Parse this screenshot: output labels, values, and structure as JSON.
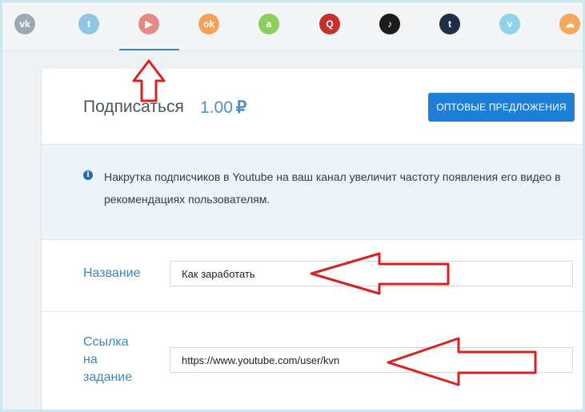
{
  "social_networks": [
    {
      "name": "vk-icon",
      "glyph": "vk",
      "color": "#9aa9b6"
    },
    {
      "name": "twitter-icon",
      "glyph": "t",
      "color": "#8fc6e8"
    },
    {
      "name": "youtube-icon",
      "glyph": "▶",
      "color": "#e68a84"
    },
    {
      "name": "odnoklassniki-icon",
      "glyph": "ok",
      "color": "#f5a35a"
    },
    {
      "name": "android-icon",
      "glyph": "a",
      "color": "#8ccf5c"
    },
    {
      "name": "quora-icon",
      "glyph": "Q",
      "color": "#c6302b"
    },
    {
      "name": "tiktok-icon",
      "glyph": "♪",
      "color": "#1b1b1b"
    },
    {
      "name": "tumblr-icon",
      "glyph": "t",
      "color": "#1f2f44"
    },
    {
      "name": "vimeo-icon",
      "glyph": "v",
      "color": "#8fd2e9"
    },
    {
      "name": "soundcloud-icon",
      "glyph": "☁",
      "color": "#f6a85c"
    }
  ],
  "header": {
    "title": "Подписаться",
    "price": "1.00",
    "currency": "₽",
    "wholesale_button": "Оптовые предложения"
  },
  "info": {
    "text": "Накрутка подписчиков в Youtube на ваш канал увеличит частоту появления его видео в рекомендациях пользователям."
  },
  "form": {
    "name_label": "Название",
    "name_value": "Как заработать",
    "link_label_line1": "Ссылка",
    "link_label_line2": "на",
    "link_label_line3": "задание",
    "link_value": "https://www.youtube.com/user/kvn"
  },
  "colors": {
    "accent": "#1e7fd6",
    "annotation": "#d92121"
  }
}
